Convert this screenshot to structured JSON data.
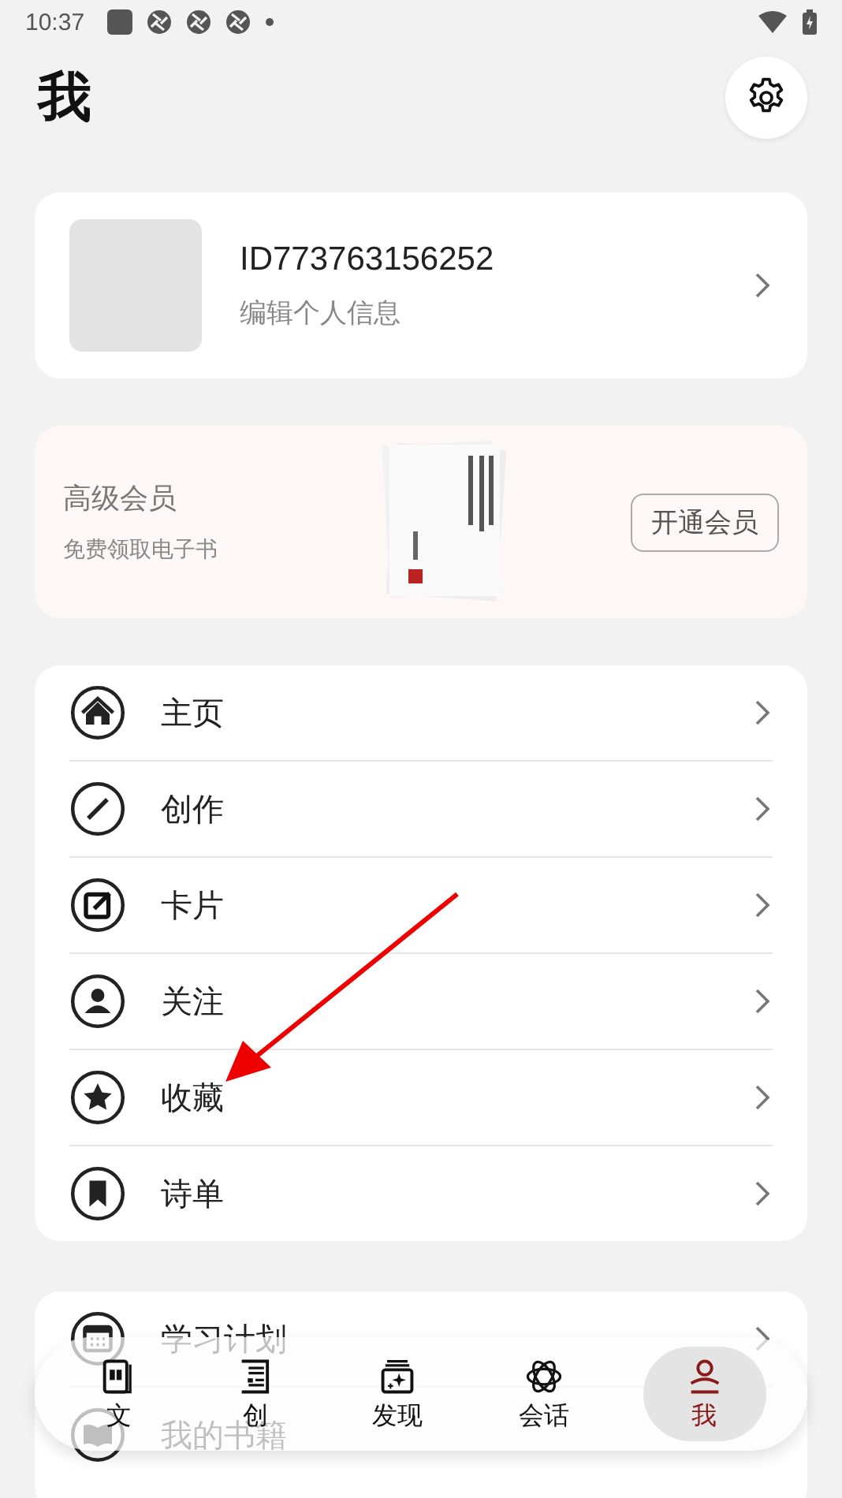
{
  "status_bar": {
    "time": "10:37"
  },
  "header": {
    "title": "我"
  },
  "profile": {
    "id": "ID773763156252",
    "subtitle": "编辑个人信息"
  },
  "membership": {
    "title": "高级会员",
    "subtitle": "免费领取电子书",
    "button": "开通会员"
  },
  "menu": [
    {
      "label": "主页"
    },
    {
      "label": "创作"
    },
    {
      "label": "卡片"
    },
    {
      "label": "关注"
    },
    {
      "label": "收藏"
    },
    {
      "label": "诗单"
    }
  ],
  "menu_2": [
    {
      "label": "学习计划"
    },
    {
      "label": "我的书籍"
    }
  ],
  "bottom_nav": [
    {
      "label": "文",
      "selected": false
    },
    {
      "label": "创",
      "selected": false
    },
    {
      "label": "发现",
      "selected": false
    },
    {
      "label": "会话",
      "selected": false
    },
    {
      "label": "我",
      "selected": true
    }
  ]
}
